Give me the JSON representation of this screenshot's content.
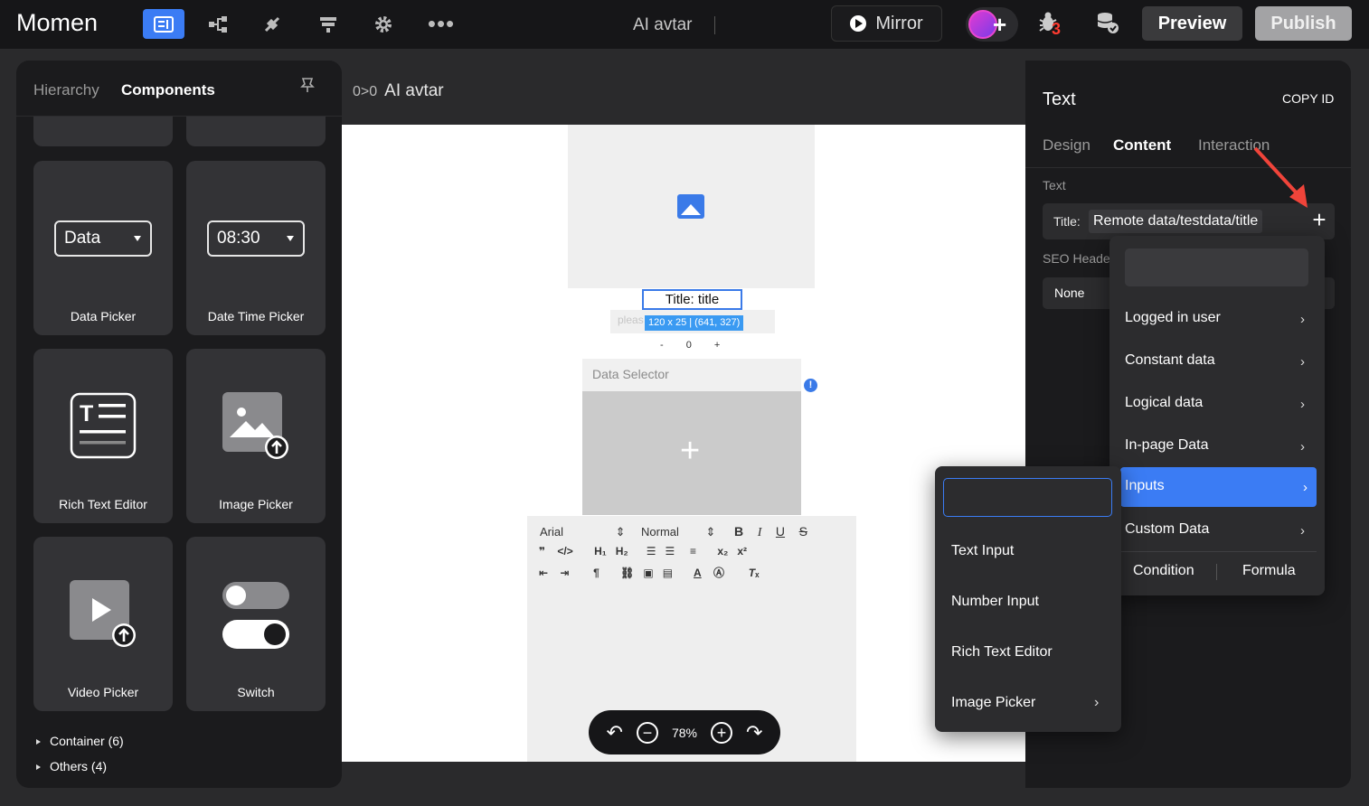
{
  "app": {
    "logo_text": "Momen",
    "document_title": "AI avtar",
    "mirror_label": "Mirror",
    "bug_count": "3",
    "preview_label": "Preview",
    "publish_label": "Publish"
  },
  "toolbar_icons": [
    "pages-icon",
    "share-tree-icon",
    "plugin-icon",
    "layers-icon",
    "settings-icon",
    "more-icon"
  ],
  "left_panel": {
    "tabs": [
      "Hierarchy",
      "Components"
    ],
    "active_tab": "Components",
    "components": [
      {
        "label": "Data Picker",
        "preview_value": "Data"
      },
      {
        "label": "Date Time Picker",
        "preview_value": "08:30"
      },
      {
        "label": "Rich Text Editor"
      },
      {
        "label": "Image Picker"
      },
      {
        "label": "Video Picker"
      },
      {
        "label": "Switch"
      }
    ],
    "tree": [
      {
        "label": "Container (6)"
      },
      {
        "label": "Others (4)"
      }
    ]
  },
  "canvas": {
    "header_code": "0>0",
    "header_title": "AI avtar",
    "title_text": "Title: title",
    "size_badge": "120 x 25 | (641, 327)",
    "input_placeholder": "pleas",
    "stepper": {
      "minus": "-",
      "value": "0",
      "plus": "+"
    },
    "data_selector_label": "Data Selector",
    "rte": {
      "font": "Arial",
      "size": "Normal"
    },
    "zoom_level": "78%"
  },
  "right_panel": {
    "title": "Text",
    "copy_id_label": "COPY ID",
    "tabs": [
      "Design",
      "Content",
      "Interaction"
    ],
    "active_tab": "Content",
    "section_text": "Text",
    "title_label": "Title:",
    "title_value": "Remote data/testdata/title",
    "seo_label": "SEO Header",
    "seo_value": "None"
  },
  "data_menu": {
    "items": [
      {
        "label": "Logged in user",
        "has_sub": true
      },
      {
        "label": "Constant data",
        "has_sub": true
      },
      {
        "label": "Logical data",
        "has_sub": true
      },
      {
        "label": "In-page Data",
        "has_sub": true
      },
      {
        "label": "Inputs",
        "has_sub": true,
        "active": true
      },
      {
        "label": "Custom Data",
        "has_sub": true
      }
    ],
    "condition_label": "Condition",
    "formula_label": "Formula"
  },
  "inputs_submenu": {
    "items": [
      {
        "label": "Text Input"
      },
      {
        "label": "Number Input"
      },
      {
        "label": "Rich Text Editor"
      },
      {
        "label": "Image Picker",
        "has_sub": true
      }
    ]
  },
  "colors": {
    "accent": "#3b7cf4",
    "annotation_arrow": "#f0443a",
    "panel_bg": "#1b1b1d"
  }
}
